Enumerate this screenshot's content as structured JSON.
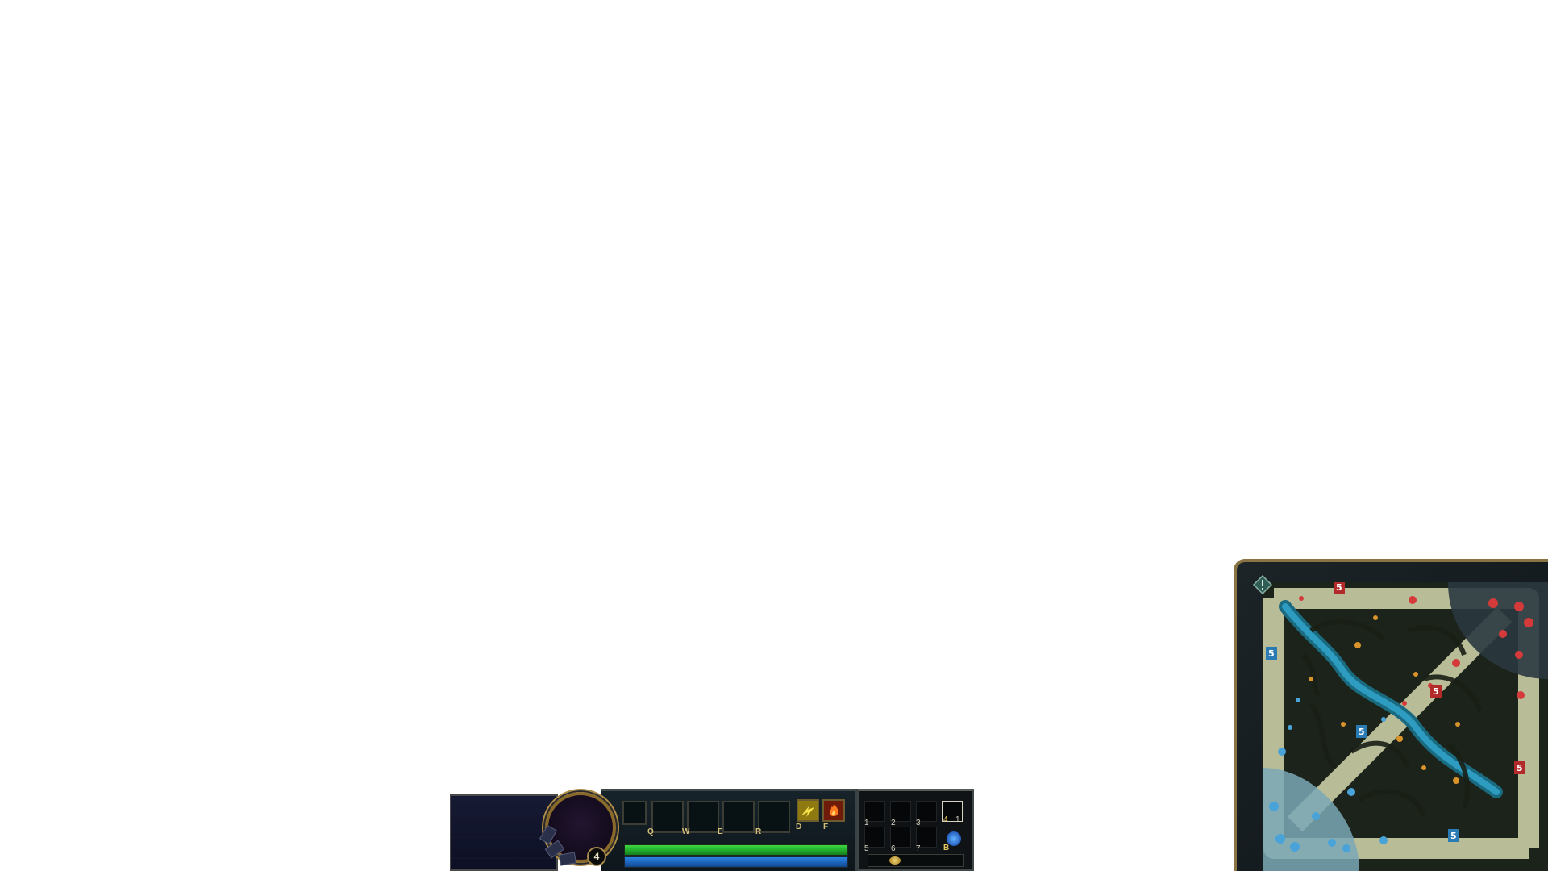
{
  "hud": {
    "level": "4",
    "abilities": [
      {
        "key": "Q"
      },
      {
        "key": "W"
      },
      {
        "key": "E"
      },
      {
        "key": "R"
      }
    ],
    "summoner_spells": [
      {
        "key": "D",
        "icon": "flash-icon",
        "color": "#e2c93a"
      },
      {
        "key": "F",
        "icon": "ignite-icon",
        "color": "#e2561e"
      }
    ],
    "health_fraction": 1.0,
    "mana_fraction": 1.0,
    "items": {
      "slot_labels": [
        "1",
        "2",
        "3",
        "5",
        "6",
        "7"
      ],
      "trinket_label": "4",
      "trinket_charges": "1",
      "recall_key": "B"
    },
    "colors": {
      "gold_border": "#a88a4c",
      "health": "#2fc23a",
      "mana": "#1f68c4",
      "blue_team": "#4aa3d8",
      "red_team": "#d43a3a"
    }
  },
  "minimap": {
    "tower_label": "5"
  }
}
